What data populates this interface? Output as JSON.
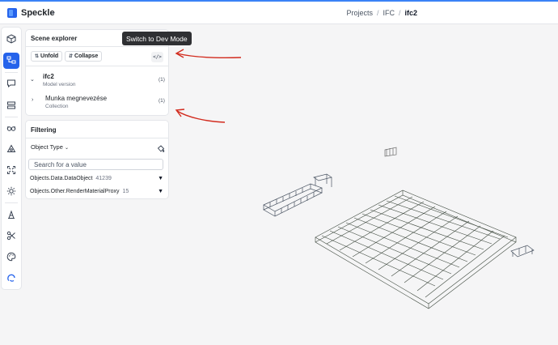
{
  "app": {
    "brand": "Speckle",
    "accent_color": "#2563eb",
    "breadcrumb": [
      "Projects",
      "IFC",
      "ifc2"
    ]
  },
  "rail": {
    "items": [
      {
        "name": "cube-icon",
        "active": false
      },
      {
        "name": "scene-tree-icon",
        "active": true
      },
      {
        "name": "comments-icon",
        "active": false
      },
      {
        "name": "filter-rows-icon",
        "active": false
      },
      {
        "name": "glasses-icon",
        "active": false
      },
      {
        "name": "views-icon",
        "active": false
      },
      {
        "name": "fit-screen-icon",
        "active": false
      },
      {
        "name": "light-icon",
        "active": false
      },
      {
        "name": "measure-icon",
        "active": false
      },
      {
        "name": "scissors-icon",
        "active": false
      },
      {
        "name": "palette-icon",
        "active": false
      },
      {
        "name": "speckle-ai-icon",
        "active": false
      }
    ]
  },
  "scene_explorer": {
    "title": "Scene explorer",
    "unfold_label": "Unfold",
    "collapse_label": "Collapse",
    "tooltip": "Switch to Dev Mode",
    "tree": [
      {
        "name": "ifc2",
        "type": "Model version",
        "count": "(1)",
        "expanded": true
      },
      {
        "name": "Munka megnevezése",
        "type": "Collection",
        "count": "(1)",
        "expanded": false
      }
    ]
  },
  "filtering": {
    "title": "Filtering",
    "property_label": "Object Type",
    "search_placeholder": "Search for a value",
    "rows": [
      {
        "label": "Objects.Data.DataObject",
        "count": "41239"
      },
      {
        "label": "Objects.Other.RenderMaterialProxy",
        "count": "15"
      }
    ]
  },
  "annotations": {
    "arrow_color": "#d22b1e"
  }
}
